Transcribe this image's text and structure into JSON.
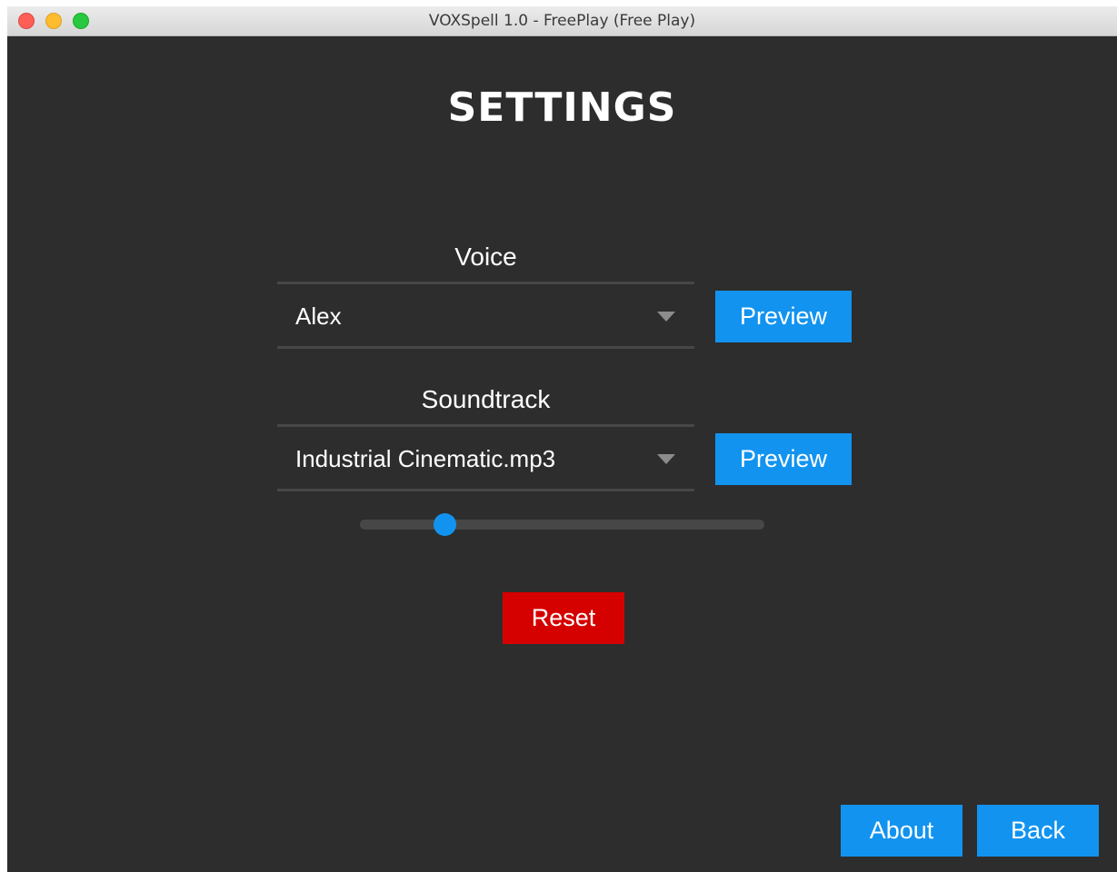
{
  "window": {
    "title": "VOXSpell 1.0 - FreePlay (Free Play)"
  },
  "page": {
    "title": "SETTINGS"
  },
  "voice": {
    "label": "Voice",
    "selected": "Alex",
    "preview_label": "Preview"
  },
  "soundtrack": {
    "label": "Soundtrack",
    "selected": "Industrial Cinematic.mp3",
    "preview_label": "Preview",
    "volume_fraction": 0.21
  },
  "actions": {
    "reset_label": "Reset",
    "about_label": "About",
    "back_label": "Back"
  },
  "colors": {
    "background": "#2d2d2d",
    "accent_blue": "#1293f0",
    "reset_red": "#d50000",
    "divider": "#474747"
  },
  "icons": {
    "dropdown": "chevron-down-icon"
  }
}
